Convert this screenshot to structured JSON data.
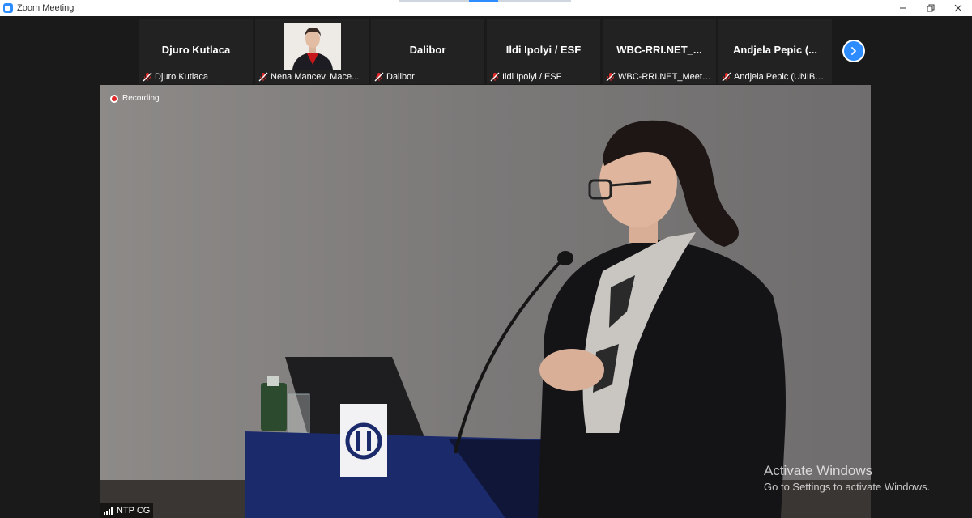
{
  "window": {
    "title": "Zoom Meeting"
  },
  "participants": [
    {
      "display": "Djuro Kutlaca",
      "label": "Djuro Kutlaca",
      "has_video": false
    },
    {
      "display": "",
      "label": "Nena Mancev, Mace...",
      "has_video": true
    },
    {
      "display": "Dalibor",
      "label": "Dalibor",
      "has_video": false
    },
    {
      "display": "Ildi Ipolyi / ESF",
      "label": "Ildi Ipolyi / ESF",
      "has_video": false
    },
    {
      "display": "WBC-RRI.NET_...",
      "label": "WBC-RRI.NET_Meetin...",
      "has_video": false
    },
    {
      "display": "Andjela Pepic (...",
      "label": "Andjela Pepic (UNIBL,...",
      "has_video": false
    }
  ],
  "recording": {
    "label": "Recording"
  },
  "active_speaker": {
    "label": "NTP CG"
  },
  "watermark": {
    "title": "Activate Windows",
    "subtitle": "Go to Settings to activate Windows."
  },
  "icons": {
    "mic": "mic-muted-icon",
    "next": "chevron-right-icon",
    "record": "record-icon",
    "signal": "signal-bars-icon"
  },
  "colors": {
    "accent": "#2d8cff",
    "muted": "#e02828",
    "tile_bg": "#222222"
  }
}
